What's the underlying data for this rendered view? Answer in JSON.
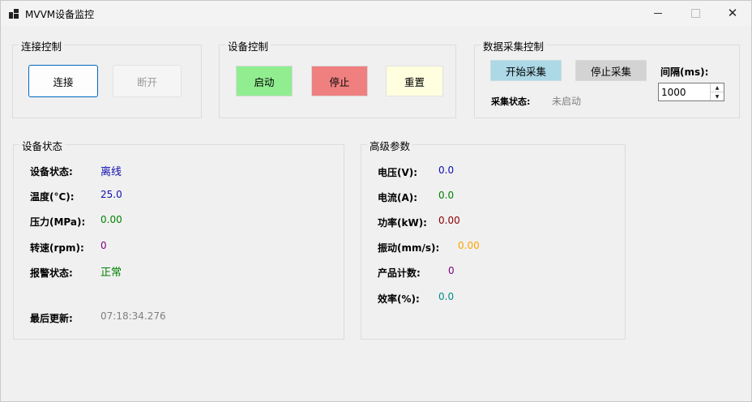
{
  "window": {
    "title": "MVVM设备监控"
  },
  "connection": {
    "title": "连接控制",
    "connect_label": "连接",
    "disconnect_label": "断开"
  },
  "device_control": {
    "title": "设备控制",
    "start_label": "启动",
    "stop_label": "停止",
    "reset_label": "重置"
  },
  "acquisition": {
    "title": "数据采集控制",
    "start_label": "开始采集",
    "stop_label": "停止采集",
    "status_label": "采集状态:",
    "status_value": "未启动",
    "interval_label": "间隔(ms):",
    "interval_value": "1000"
  },
  "device_status": {
    "title": "设备状态",
    "rows": [
      {
        "label": "设备状态:",
        "value": "离线"
      },
      {
        "label": "温度(°C):",
        "value": "25.0"
      },
      {
        "label": "压力(MPa):",
        "value": "0.00"
      },
      {
        "label": "转速(rpm):",
        "value": "0"
      },
      {
        "label": "报警状态:",
        "value": "正常"
      }
    ],
    "last_update_label": "最后更新:",
    "last_update_value": "07:18:34.276"
  },
  "advanced": {
    "title": "高级参数",
    "rows": [
      {
        "label": "电压(V):",
        "value": "0.0"
      },
      {
        "label": "电流(A):",
        "value": "0.0"
      },
      {
        "label": "功率(kW):",
        "value": "0.00"
      },
      {
        "label": "振动(mm/s):",
        "value": "0.00"
      },
      {
        "label": "产品计数:",
        "value": "0"
      },
      {
        "label": "效率(%):",
        "value": "0.0"
      }
    ]
  },
  "colors": {
    "start_green": "#90ee90",
    "stop_red": "#f08080",
    "reset_yellow": "#ffffe0",
    "acq_start_blue": "#add8e6",
    "acq_stop_gray": "#d3d3d3",
    "offline_blue": "#1010b0",
    "normal_green": "#008000",
    "power_brown": "#8b0000",
    "vibration_orange": "#ffa500",
    "count_purple": "#800080",
    "efficiency_teal": "#008b8b"
  }
}
